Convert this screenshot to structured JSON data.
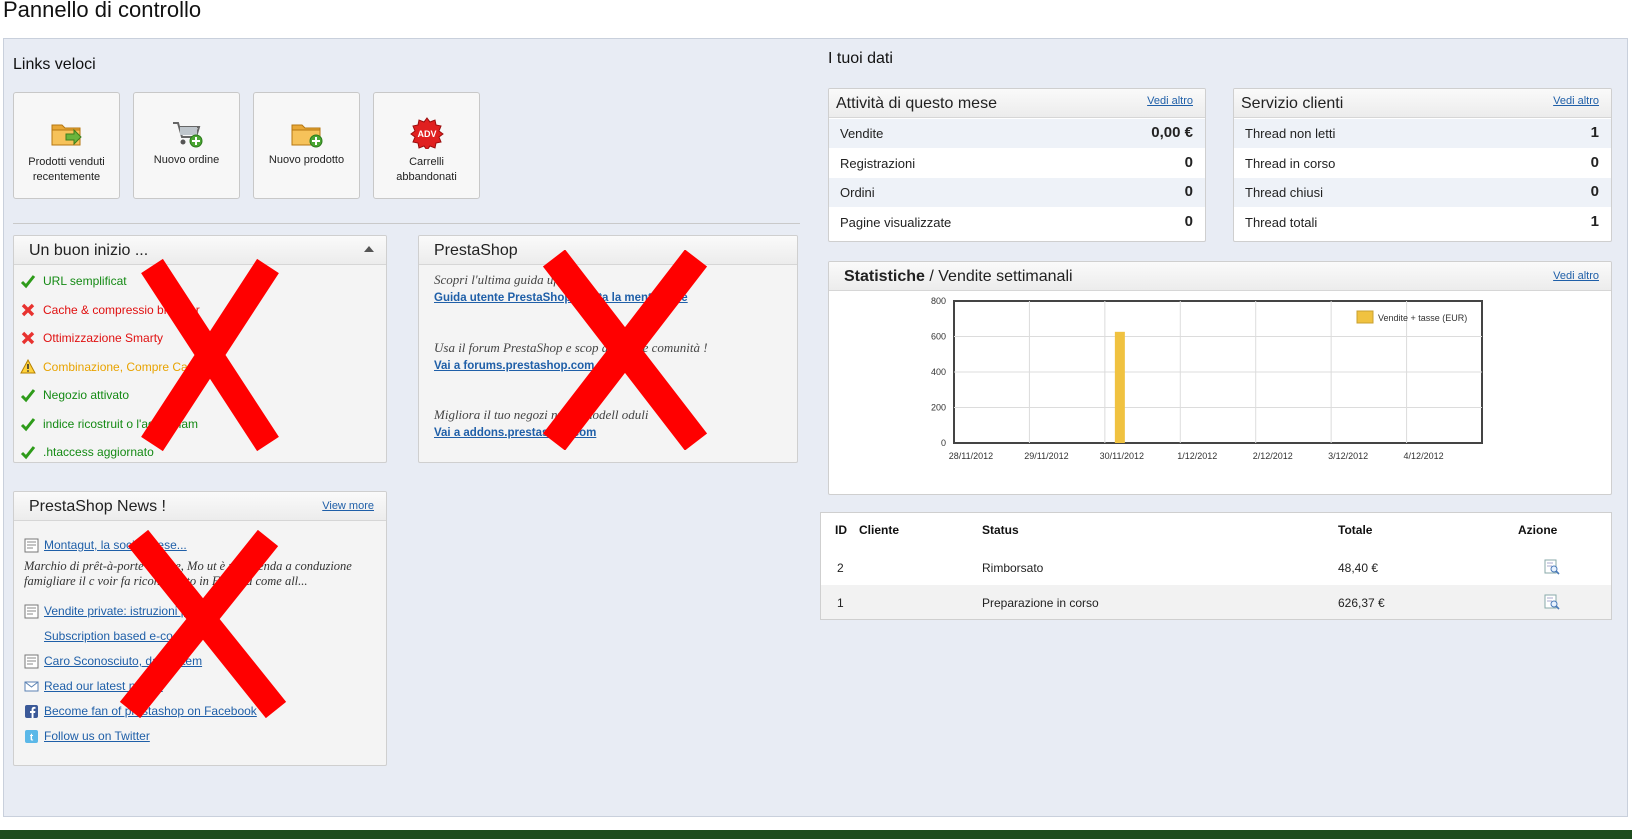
{
  "page_title": "Pannello di controllo",
  "quick_links": {
    "title": "Links veloci",
    "items": [
      {
        "label": "Prodotti venduti recentemente",
        "icon": "folder-arrow-icon"
      },
      {
        "label": "Nuovo ordine",
        "icon": "cart-add-icon"
      },
      {
        "label": "Nuovo prodotto",
        "icon": "folder-add-icon"
      },
      {
        "label": "Carrelli abbandonati",
        "icon": "adv-badge-icon"
      }
    ]
  },
  "good_start": {
    "title": "Un buon inizio ...",
    "items": [
      {
        "text": "URL semplificat",
        "status": "ok"
      },
      {
        "text": "Cache & compressio      browser",
        "status": "err"
      },
      {
        "text": "Ottimizzazione Smarty",
        "status": "err"
      },
      {
        "text": "Combinazione, Compre        Cache",
        "status": "warn"
      },
      {
        "text": "Negozio attivato",
        "status": "ok"
      },
      {
        "text": "indice ricostruit      o l'aggiornam",
        "status": "ok"
      },
      {
        "text": ".htaccess aggiornato",
        "status": "ok"
      }
    ]
  },
  "prestashop": {
    "title": "PrestaShop",
    "blocks": [
      {
        "text": "Scopri l'ultima guida uf       le:",
        "link": "Guida utente PrestaShop 1.      utta la      mentazione"
      },
      {
        "text": "Usa il forum PrestaShop e scop      a grande comunità !",
        "link": "Vai a forums.prestashop.com"
      },
      {
        "text": "Migliora il tuo negozi       nuovi modell      oduli",
        "link": "Vai a addons.prestashop.com"
      }
    ]
  },
  "news": {
    "title": "PrestaShop News !",
    "more": "View more",
    "first_link": "Montagut, la soci       ancese...",
    "description": "Marchio di prêt-à-porte      ancese, Mo      ut è un'azienda a conduzione famigliare il c      voir fa      riconosciuto in Francia come all...",
    "links": [
      {
        "text": "Vendite private: istruzioni p",
        "icon": "news-icon",
        "indent": false
      },
      {
        "text": "Subscription based e-co           n...",
        "icon": "",
        "indent": true
      },
      {
        "text": "Caro Sconosciuto, da      nto tem",
        "icon": "news-icon",
        "indent": false
      },
      {
        "text": "Read our latest ne       tter",
        "icon": "mail-icon",
        "indent": false
      },
      {
        "text": "Become fan of prestashop on Facebook",
        "icon": "facebook-icon",
        "indent": false
      },
      {
        "text": "Follow us on Twitter",
        "icon": "twitter-icon",
        "indent": false
      }
    ]
  },
  "your_data": {
    "title": "I tuoi dati",
    "activity": {
      "title": "Attività di questo mese",
      "more": "Vedi altro",
      "rows": [
        {
          "k": "Vendite",
          "v": "0,00 €"
        },
        {
          "k": "Registrazioni",
          "v": "0"
        },
        {
          "k": "Ordini",
          "v": "0"
        },
        {
          "k": "Pagine visualizzate",
          "v": "0"
        }
      ]
    },
    "service": {
      "title": "Servizio clienti",
      "more": "Vedi altro",
      "rows": [
        {
          "k": "Thread non letti",
          "v": "1"
        },
        {
          "k": "Thread in corso",
          "v": "0"
        },
        {
          "k": "Thread chiusi",
          "v": "0"
        },
        {
          "k": "Thread totali",
          "v": "1"
        }
      ]
    }
  },
  "stats": {
    "title_bold": "Statistiche",
    "title_rest": " / Vendite settimanali",
    "more": "Vedi altro"
  },
  "chart_data": {
    "type": "bar",
    "categories": [
      "28/11/2012",
      "29/11/2012",
      "30/11/2012",
      "1/12/2012",
      "2/12/2012",
      "3/12/2012",
      "4/12/2012"
    ],
    "series": [
      {
        "name": "Vendite + tasse (EUR)",
        "values": [
          0,
          0,
          626.37,
          0,
          0,
          0,
          0
        ],
        "color": "#f0c240"
      }
    ],
    "yticks": [
      "0",
      "200",
      "400",
      "600",
      "800"
    ],
    "ylim": [
      0,
      800
    ],
    "legend": "top-right",
    "grid": true
  },
  "orders": {
    "headers": {
      "id": "ID",
      "client": "Cliente",
      "status": "Status",
      "total": "Totale",
      "action": "Azione"
    },
    "rows": [
      {
        "id": "2",
        "client": "",
        "status": "Rimborsato",
        "total": "48,40 €"
      },
      {
        "id": "1",
        "client": "",
        "status": "Preparazione in corso",
        "total": "626,37 €"
      }
    ]
  },
  "colors": {
    "accent": "#1f5fa8",
    "ok": "#148a14",
    "err": "#e01010",
    "warn": "#e8a300",
    "bar": "#f0c240",
    "x_overlay": "#ff0000"
  }
}
